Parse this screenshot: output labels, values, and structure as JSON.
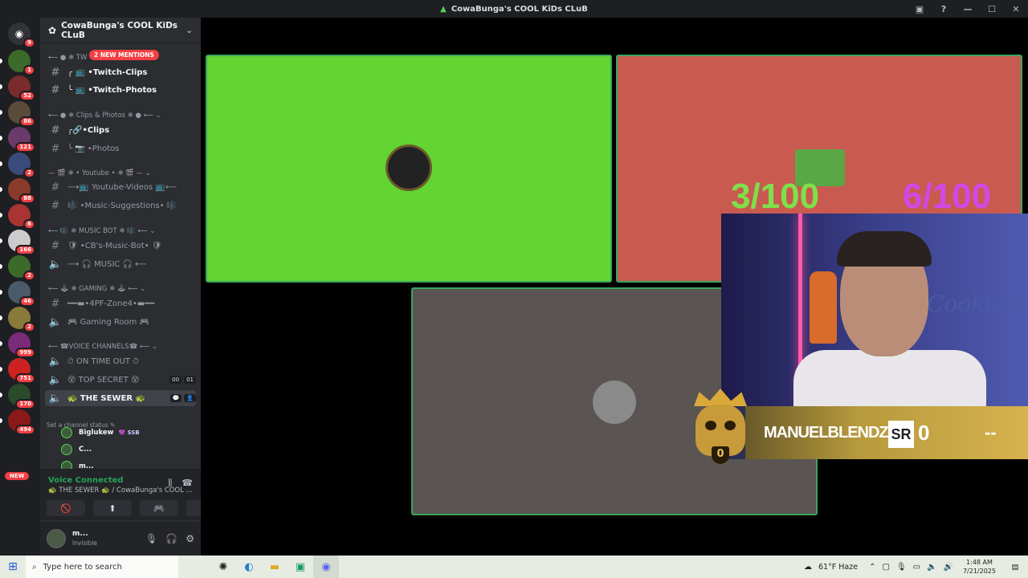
{
  "window": {
    "title": "CowaBunga's COOL KiDs CLuB"
  },
  "server_rail": {
    "servers": [
      {
        "badge": "9"
      },
      {
        "badge": "1"
      },
      {
        "badge": "52"
      },
      {
        "badge": "86"
      },
      {
        "badge": "121"
      },
      {
        "badge": "2"
      },
      {
        "badge": "88"
      },
      {
        "badge": "6"
      },
      {
        "badge": "166"
      },
      {
        "badge": "2"
      },
      {
        "badge": "46"
      },
      {
        "badge": "2"
      },
      {
        "badge": "999"
      },
      {
        "badge": "751"
      },
      {
        "badge": "170"
      },
      {
        "badge": "494"
      }
    ],
    "new_label": "NEW"
  },
  "guild": {
    "name": "CowaBunga's COOL KiDs CLuB",
    "mentions_label": "2 NEW MENTIONS"
  },
  "channels": [
    {
      "kind": "category",
      "label": "⟵ ● ❄ TW"
    },
    {
      "kind": "text",
      "label": "╭ 📺 •Twitch-Clips",
      "style": "bright"
    },
    {
      "kind": "text",
      "label": "╰ 📺 •Twitch-Photos",
      "style": "bright"
    },
    {
      "kind": "category",
      "label": "⟵ ● ❄ Clips & Photos ❄ ● ⟵ ⌄"
    },
    {
      "kind": "text",
      "label": "╭🔗•Clips",
      "style": "bright"
    },
    {
      "kind": "text",
      "label": "╰ 📷 •Photos",
      "style": "dim"
    },
    {
      "kind": "category",
      "label": "— 🎬 ❄ • Youtube • ❄ 🎬 — ⌄"
    },
    {
      "kind": "text",
      "label": "⟶📺 Youtube-Videos 📺⟵",
      "style": "dim"
    },
    {
      "kind": "text",
      "label": "🎼 •Music-Suggestions• 🎼",
      "style": "dim"
    },
    {
      "kind": "category",
      "label": "⟵ 🎼 ❄ MUSIC BOT ❄ 🎼 ⟵ ⌄"
    },
    {
      "kind": "text",
      "label": "🛡 •CB's-Music-Bot• 🛡",
      "style": "dim"
    },
    {
      "kind": "voice",
      "label": "⟶ 🎧 MUSIC 🎧 ⟵",
      "style": "dim"
    },
    {
      "kind": "category",
      "label": "⟵ 🕹 ❄ GAMING ❄ 🕹 ⟵ ⌄"
    },
    {
      "kind": "text",
      "label": "━━▬•4PF-Zone4•▬━━",
      "style": "dim"
    },
    {
      "kind": "voice",
      "label": "🎮 Gaming Room 🎮",
      "style": "dim"
    },
    {
      "kind": "category",
      "label": "⟵ ☎VOICE CHANNELS☎ ⟵ ⌄"
    },
    {
      "kind": "voice",
      "label": "⏱ ON TIME OUT ⏱",
      "style": "dim"
    },
    {
      "kind": "voice",
      "label": "😵 TOP SECRET 😵",
      "style": "dim",
      "stats": [
        "00",
        "01"
      ]
    },
    {
      "kind": "voice",
      "label": "🐢 THE SEWER 🐢",
      "style": "active"
    }
  ],
  "channel_status_hint": "Set a channel status ✎",
  "voice_users": [
    {
      "name": "Biglukew",
      "tag": "💜 SSB"
    },
    {
      "name": "C..."
    },
    {
      "name": "m..."
    }
  ],
  "voice_panel": {
    "status": "Voice Connected",
    "subtitle": "🐢 THE SEWER 🐢 / CowaBunga's COOL ...",
    "buttons": [
      "🚫",
      "⬆",
      "🎮",
      "✨"
    ]
  },
  "user_panel": {
    "name": "m...",
    "status": "Invisible"
  },
  "stage": {
    "tiles": [
      {
        "color": "#63d532",
        "has_avatar": true
      },
      {
        "color": "#c95a50",
        "has_avatar": true
      },
      {
        "color": "#5a5552",
        "has_avatar": true
      }
    ],
    "scores": [
      {
        "text": "3/100",
        "color": "#7ee04a"
      },
      {
        "text": "6/100",
        "color": "#d247e6"
      }
    ]
  },
  "overlay": {
    "player_name": "MANUELBLENDZ",
    "sr_label": "SR",
    "sr_value": "0",
    "placeholder": "--",
    "rank_number": "0",
    "wall_text": "Cookies"
  },
  "taskbar": {
    "search_placeholder": "Type here to search",
    "weather": "61°F  Haze",
    "time": "1:48 AM",
    "date": "7/21/2025"
  }
}
